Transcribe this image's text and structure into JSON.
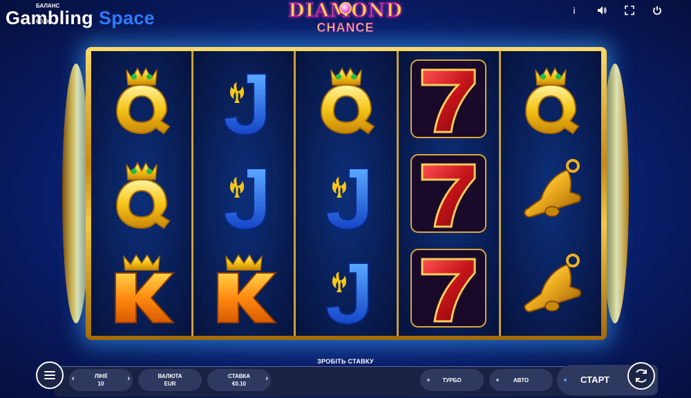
{
  "watermark": {
    "part1": "Gambling",
    "part2": "Space"
  },
  "balance": {
    "label": "БАЛАНС",
    "value": "€0.00"
  },
  "logo": {
    "line1": "DIAMOND",
    "line2": "CHANCE"
  },
  "top_icons": [
    "info-icon",
    "sound-icon",
    "fullscreen-icon",
    "power-icon"
  ],
  "top_labels": {
    "info": "i"
  },
  "reels": [
    [
      "queen",
      "queen",
      "king"
    ],
    [
      "jack",
      "jack",
      "king"
    ],
    [
      "queen",
      "jack",
      "jack"
    ],
    [
      "seven",
      "seven",
      "seven"
    ],
    [
      "queen",
      "bell",
      "bell"
    ]
  ],
  "controls": {
    "make_bet": "ЗРОБІТЬ СТАВКУ",
    "lines_label": "ЛІНІЇ",
    "lines_value": "10",
    "currency_label": "ВАЛЮТА",
    "currency_value": "EUR",
    "stake_label": "СТАВКА",
    "stake_value": "€0.10",
    "turbo": "ТУРБО",
    "auto": "АВТО",
    "start": "СТАРТ"
  },
  "colors": {
    "background": "#0e2a8a",
    "gold": "#f3c744",
    "accent_blue": "#2f7bff",
    "pill": "#2f3960"
  }
}
